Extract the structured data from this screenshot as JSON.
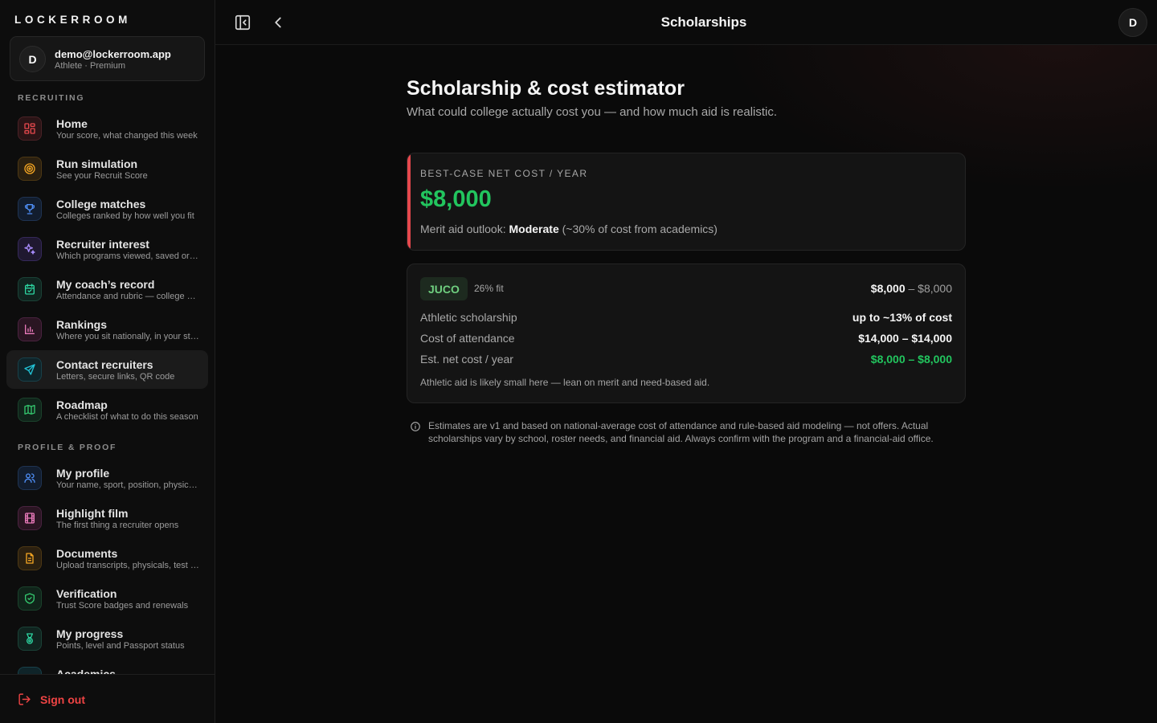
{
  "brand": "LOCKERROOM",
  "account": {
    "initial": "D",
    "email": "demo@lockerroom.app",
    "role": "Athlete · Premium"
  },
  "sections": {
    "recruiting": "RECRUITING",
    "profile": "PROFILE & PROOF"
  },
  "nav": {
    "home": {
      "title": "Home",
      "subtitle": "Your score, what changed this week"
    },
    "simulation": {
      "title": "Run simulation",
      "subtitle": "See your Recruit Score"
    },
    "matches": {
      "title": "College matches",
      "subtitle": "Colleges ranked by how well you fit"
    },
    "interest": {
      "title": "Recruiter interest",
      "subtitle": "Which programs viewed, saved or contacted you"
    },
    "coach": {
      "title": "My coach’s record",
      "subtitle": "Attendance and rubric — college coaches see this"
    },
    "rankings": {
      "title": "Rankings",
      "subtitle": "Where you sit nationally, in your state"
    },
    "contact": {
      "title": "Contact recruiters",
      "subtitle": "Letters, secure links, QR code"
    },
    "roadmap": {
      "title": "Roadmap",
      "subtitle": "A checklist of what to do this season"
    },
    "profile": {
      "title": "My profile",
      "subtitle": "Your name, sport, position, physicals"
    },
    "film": {
      "title": "Highlight film",
      "subtitle": "The first thing a recruiter opens"
    },
    "documents": {
      "title": "Documents",
      "subtitle": "Upload transcripts, physicals, test scores"
    },
    "verification": {
      "title": "Verification",
      "subtitle": "Trust Score badges and renewals"
    },
    "progress": {
      "title": "My progress",
      "subtitle": "Points, level and Passport status"
    },
    "academics": {
      "title": "Academics",
      "subtitle": ""
    }
  },
  "signout": "Sign out",
  "topbar": {
    "title": "Scholarships",
    "avatar": "D"
  },
  "page": {
    "heading": "Scholarship & cost estimator",
    "lead": "What could college actually cost you — and how much aid is realistic."
  },
  "best_case": {
    "label": "BEST-CASE NET COST / YEAR",
    "amount": "$8,000",
    "merit_prefix": "Merit aid outlook: ",
    "merit_level": "Moderate",
    "merit_suffix": " (~30% of cost from academics)"
  },
  "tier": {
    "name": "JUCO",
    "fit": "26% fit",
    "range_low": "$8,000",
    "range_rest": " – $8,000",
    "rows": [
      {
        "label": "Athletic scholarship",
        "value": "up to ~13% of cost"
      },
      {
        "label": "Cost of attendance",
        "value": "$14,000 – $14,000"
      },
      {
        "label": "Est. net cost / year",
        "value": "$8,000 – $8,000"
      }
    ],
    "note": "Athletic aid is likely small here — lean on merit and need-based aid."
  },
  "disclaimer": "Estimates are v1 and based on national-average cost of attendance and rule-based aid modeling — not offers. Actual scholarships vary by school, roster needs, and financial aid. Always confirm with the program and a financial-aid office.",
  "colors": {
    "accent_red": "#e5484d",
    "money_green": "#22c55e",
    "signout_red": "#ef4444"
  }
}
